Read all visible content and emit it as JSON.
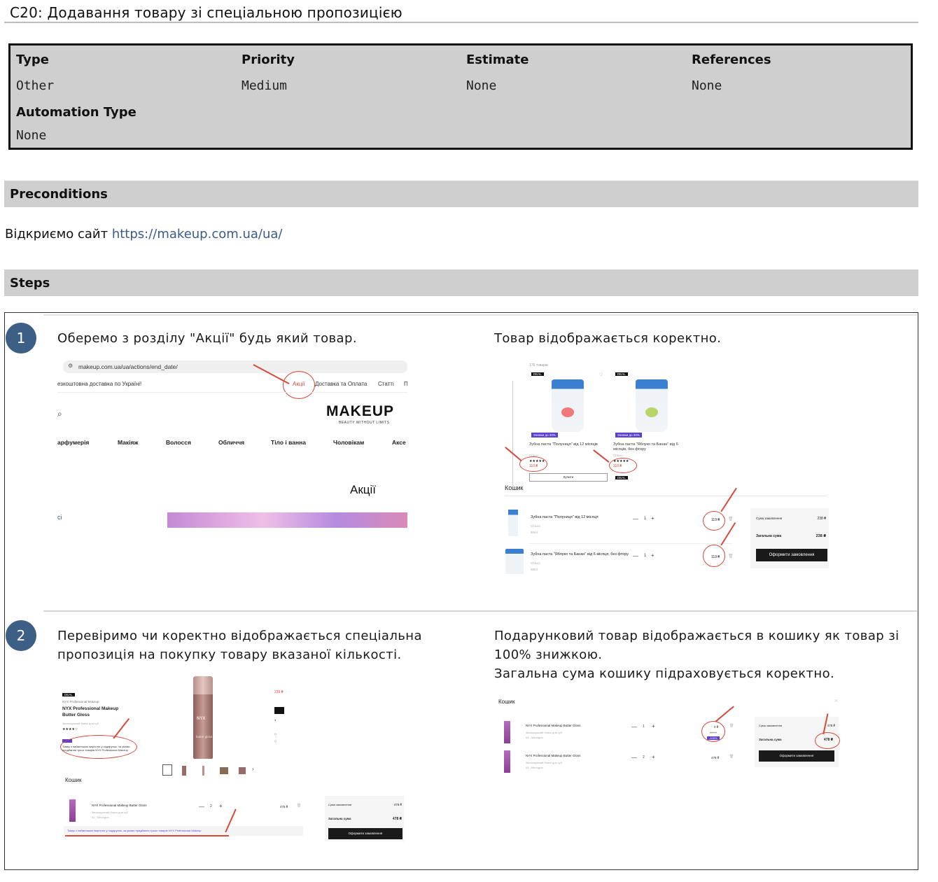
{
  "case": {
    "title": "C20: Додавання товару зі спеціальною пропозицією"
  },
  "meta": {
    "type_label": "Type",
    "type_value": "Other",
    "priority_label": "Priority",
    "priority_value": "Medium",
    "estimate_label": "Estimate",
    "estimate_value": "None",
    "references_label": "References",
    "references_value": "None",
    "automation_label": "Automation Type",
    "automation_value": "None"
  },
  "preconditions": {
    "header": "Preconditions",
    "text": "Відкриємо сайт ",
    "link": "https://makeup.com.ua/ua/"
  },
  "steps": {
    "header": "Steps",
    "items": [
      {
        "number": "1",
        "action": "Оберемо з розділу \"Акції\" будь який товар.",
        "expected": "Товар відображається коректно."
      },
      {
        "number": "2",
        "action": "Перевіримо чи коректно відображається спеціальна пропозиція на покупку товару вказаної кількості.",
        "expected_line1": "Подарунковий товар відображається в кошику як товар зі 100% знижкою.",
        "expected_line2": "Загальна сума кошику підраховується коректно."
      }
    ]
  },
  "shot1": {
    "url": "makeup.com.ua/ua/actions/end_date/",
    "topbar_left": "езкоштовна доставка по Україні!",
    "topbar_actions": "Акції",
    "topbar_delivery": "Доставка та Оплата",
    "topbar_articles": "Статті",
    "topbar_cut": "П",
    "logo": "MAKEUP",
    "logo_sub": "BEAUTY WITHOUT LIMITS",
    "nav": [
      "арфумерія",
      "Макіяж",
      "Волосся",
      "Обличчя",
      "Тіло і ванна",
      "Чоловікам",
      "Аксе"
    ],
    "heading": "Акції",
    "side_cut": "сі"
  },
  "shot2": {
    "count": "176 товарів",
    "deal": "DEAL",
    "badge_discount": "Знижки до 20%",
    "p1_name": "Зубна паста \"Полуниця\" від 12 місяців",
    "p2_name": "Зубна паста \"Яблуко та Банан\" від 6 місяців, без фтору",
    "brand": "Chicco",
    "price1": "110 ₴",
    "price2": "110 ₴",
    "buy": "Купити",
    "cart_title": "Кошик",
    "c1_name": "Зубна паста \"Полуниця\" від 12 місяця",
    "c2_name": "Зубна паста \"Яблуко та Банан\" від 6 місяця, без фтору",
    "c_sub1": "Chicco",
    "c_sub2": "50ml",
    "qty": "1",
    "c_price": "119 ₴",
    "sum_label": "Сума замовлення",
    "sum_value": "238 ₴",
    "total_label": "Загальна сума",
    "total_value": "238 ₴",
    "checkout": "Оформити замовлення"
  },
  "shot3": {
    "price": "239 ₴",
    "deal": "DEAL",
    "brand_line": "NYX Professional Makeup",
    "name": "NYX Professional Makeup Butter Gloss",
    "sub": "Зволожуючий блиск для губ",
    "offer": "Товар з найменшою вартістю у подарунок, за умови придбання трьох товарів NYX Professional Makeup",
    "cart_title": "Кошик",
    "c_name": "NYX Professional Makeup Butter Gloss",
    "c_sub1": "Зволожуючий блиск для губ",
    "c_sub2": "04 - Meringue",
    "qty": "2",
    "c_price": "478 ₴",
    "sum_label": "Сума замовлення",
    "sum_value": "478 ₴",
    "total_label": "Загальна сума",
    "total_value": "478 ₴",
    "checkout": "Оформити замовлення",
    "tube_text": "butter gloss",
    "tube_brand": "NYX"
  },
  "shot4": {
    "cart_title": "Кошик",
    "close": "×",
    "r1_name": "NYX Professional Makeup Butter Gloss",
    "r1_sub1": "Зволожуючий блиск для губ",
    "r1_sub2": "04 - Meringue",
    "r1_qty": "1",
    "r1_price": "0 ₴",
    "r1_old": "239 ₴",
    "r1_badge": "-100%",
    "r2_name": "NYX Professional Makeup Butter Gloss",
    "r2_sub1": "Зволожуючий блиск для губ",
    "r2_sub2": "04 - Meringue",
    "r2_qty": "2",
    "r2_price": "478 ₴",
    "sum_label": "Сума замовлення",
    "sum_value": "478 ₴",
    "total_label": "Загальна сума",
    "total_value": "478 ₴",
    "checkout": "Оформити замовлення"
  },
  "colors": {
    "badge": "#3d5f86",
    "annotation": "#d8493a",
    "section": "#cfcfcf",
    "link": "#3a5a8c",
    "promo": "#5b3fd1"
  }
}
